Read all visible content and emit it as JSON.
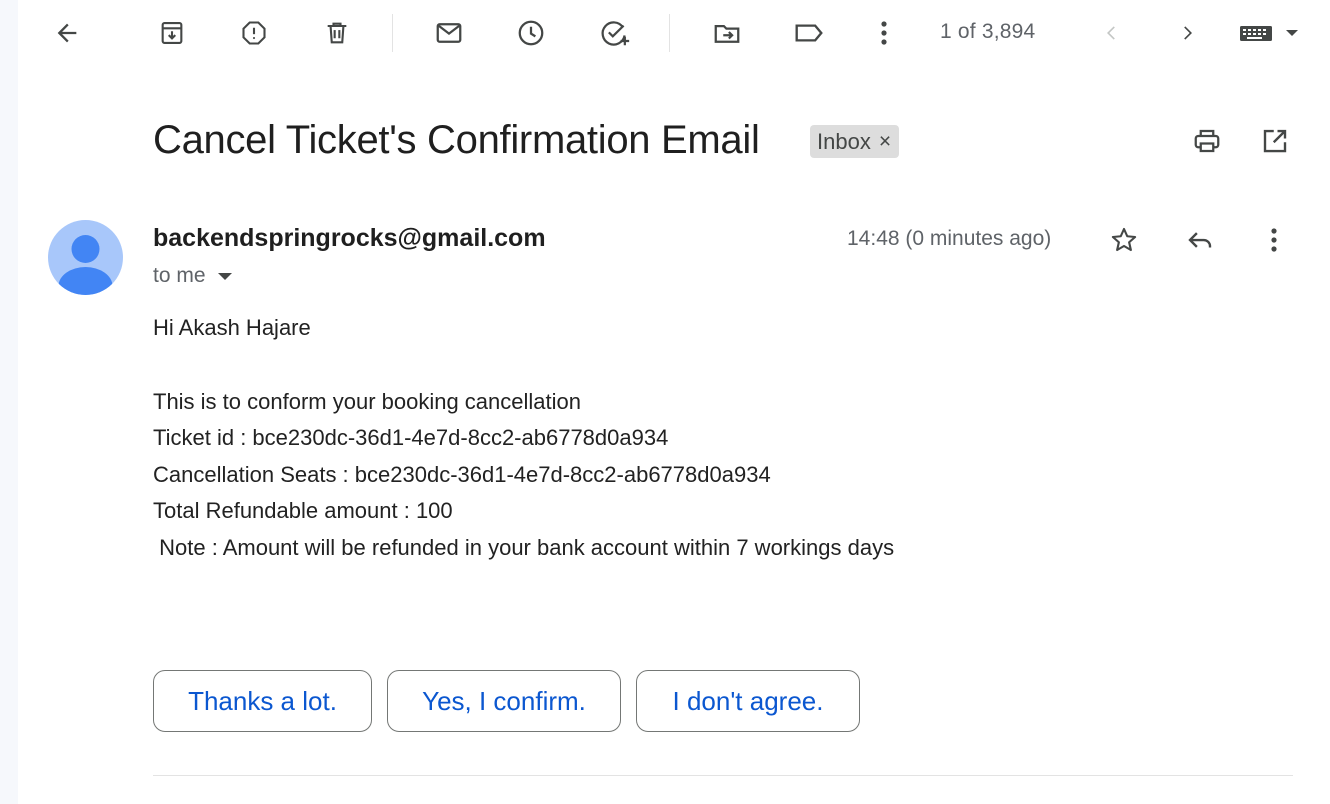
{
  "toolbar": {
    "icons": [
      "back-arrow-icon",
      "archive-icon",
      "report-spam-icon",
      "delete-icon",
      "mark-unread-icon",
      "snooze-icon",
      "add-to-tasks-icon",
      "move-to-icon",
      "label-icon",
      "more-vert-icon"
    ],
    "pager": "1 of 3,894"
  },
  "email": {
    "subject": "Cancel Ticket's Confirmation Email",
    "label": "Inbox",
    "label_close": "×",
    "sender": "backendspringrocks@gmail.com",
    "recipient": "to me",
    "time": "14:48 (0 minutes ago)",
    "body": {
      "greeting": "Hi Akash Hajare",
      "line1": "This is to conform your booking cancellation",
      "line2": "Ticket id : bce230dc-36d1-4e7d-8cc2-ab6778d0a934",
      "line3": "Cancellation Seats : bce230dc-36d1-4e7d-8cc2-ab6778d0a934",
      "line4": "Total Refundable amount : 100",
      "line5": " Note : Amount will be refunded in your bank account within 7 workings days"
    }
  },
  "smart_replies": [
    "Thanks a lot.",
    "Yes, I confirm.",
    "I don't agree."
  ],
  "colors": {
    "link_blue": "#0b57d0",
    "avatar_bg": "#a8c7fa",
    "avatar_fg": "#4285f4"
  }
}
